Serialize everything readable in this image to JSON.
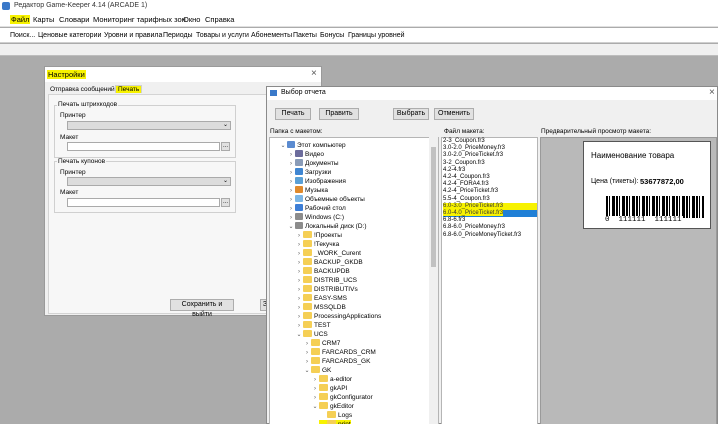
{
  "app": {
    "title": "Редактор Game-Keeper 4.14 (ARCADE 1)"
  },
  "menu": [
    "Файл",
    "Карты",
    "Словари",
    "Мониторинг тарифных зон",
    "Окно",
    "Справка"
  ],
  "toolbar": [
    "Поиск...",
    "Ценовые категории",
    "Уровни и правила",
    "Периоды",
    "Товары и услуги",
    "Абонементы",
    "Пакеты",
    "Бонусы",
    "Границы уровней"
  ],
  "settings": {
    "title": "Настройки",
    "close": "×",
    "tabs": [
      "Отправка сообщений",
      "Печать"
    ],
    "barcode_group": "Печать штрихкодов",
    "coupon_group": "Печать купонов",
    "printer_label": "Принтер",
    "layout_label": "Макет",
    "dots": "...",
    "save_button": "Сохранить и выйти",
    "cut_button": "З"
  },
  "report": {
    "title": "Выбор отчета",
    "close": "×",
    "buttons": {
      "print": "Печать",
      "edit": "Править",
      "select": "Выбрать",
      "cancel": "Отменить"
    },
    "folder_header": "Папка с макетом:",
    "file_header": "Файл макета:",
    "preview_header": "Предварительный просмотр макета:",
    "tree": [
      {
        "label": "Этот компьютер",
        "icon": "computer-icon"
      },
      {
        "label": "Видео",
        "icon": "video-icon"
      },
      {
        "label": "Документы",
        "icon": "documents-icon"
      },
      {
        "label": "Загрузки",
        "icon": "downloads-icon"
      },
      {
        "label": "Изображения",
        "icon": "images-icon"
      },
      {
        "label": "Музыка",
        "icon": "music-icon"
      },
      {
        "label": "Объемные объекты",
        "icon": "3d-objects-icon"
      },
      {
        "label": "Рабочий стол",
        "icon": "desktop-icon"
      },
      {
        "label": "Windows (C:)",
        "icon": "drive-icon"
      },
      {
        "label": "Локальный диск (D:)",
        "icon": "drive-icon"
      },
      {
        "label": "!Проекты",
        "icon": "folder-icon"
      },
      {
        "label": "!Текучка",
        "icon": "folder-icon"
      },
      {
        "label": "_WORK_Curent",
        "icon": "folder-icon"
      },
      {
        "label": "BACKUP_GKDB",
        "icon": "folder-icon"
      },
      {
        "label": "BACKUPDB",
        "icon": "folder-icon"
      },
      {
        "label": "DISTRIB_UCS",
        "icon": "folder-icon"
      },
      {
        "label": "DISTRIBUTIVs",
        "icon": "folder-icon"
      },
      {
        "label": "EASY-SMS",
        "icon": "folder-icon"
      },
      {
        "label": "MSSQLDB",
        "icon": "folder-icon"
      },
      {
        "label": "ProcessingApplications",
        "icon": "folder-icon"
      },
      {
        "label": "TEST",
        "icon": "folder-icon"
      },
      {
        "label": "UCS",
        "icon": "folder-icon"
      },
      {
        "label": "CRM7",
        "icon": "folder-icon"
      },
      {
        "label": "FARCARDS_CRM",
        "icon": "folder-icon"
      },
      {
        "label": "FARCARDS_GK",
        "icon": "folder-icon"
      },
      {
        "label": "GK",
        "icon": "folder-icon"
      },
      {
        "label": "a-editor",
        "icon": "folder-icon"
      },
      {
        "label": "gkAPI",
        "icon": "folder-icon"
      },
      {
        "label": "gkConfigurator",
        "icon": "folder-icon"
      },
      {
        "label": "gkEditor",
        "icon": "folder-icon"
      },
      {
        "label": "Logs",
        "icon": "folder-icon"
      },
      {
        "label": "print",
        "icon": "folder-icon"
      }
    ],
    "files": [
      "2-3_Coupon.fr3",
      "3.0-2.0_PriceMoney.fr3",
      "3.0-2.0_PriceTicket.fr3",
      "3-2_Coupon.fr3",
      "4.2-4.fr3",
      "4.2-4_Coupon.fr3",
      "4.2-4_FORA4.fr3",
      "4.2-4_PriceTicket.fr3",
      "5.5-4_Coupon.fr3",
      "6.0-3.0_PriceTicket.fr3",
      "6.0-4.0_PriceTicket.fr3",
      "6.8-6.fr3",
      "6.8-6.0_PriceMoney.fr3",
      "6.8-6.0_PriceMoneyTicket.fr3"
    ],
    "preview": {
      "product_name": "Наименование товара",
      "price_label": "Цена (тикеты):",
      "price_value": "53677872,00",
      "barcode_digits": "0  111111  111111"
    }
  }
}
